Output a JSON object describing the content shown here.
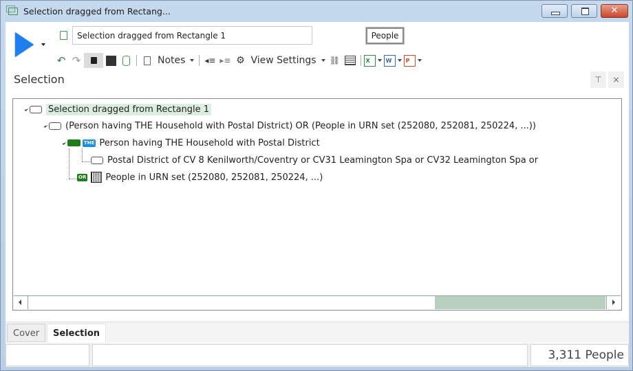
{
  "window": {
    "title": "Selection dragged from Rectang...",
    "controls": {
      "minimize": "minimize",
      "maximize": "maximize",
      "close": "✕"
    }
  },
  "header": {
    "selection_name": "Selection dragged from Rectangle 1",
    "resolve_table": "People"
  },
  "toolbar": {
    "notes_label": "Notes",
    "view_settings_label": "View Settings",
    "icons": [
      "undo-icon",
      "redo-icon",
      "lock-icon",
      "save-icon",
      "database-icon",
      "clipboard-icon",
      "outdent-icon",
      "indent-icon",
      "settings-doc-icon",
      "tree-icon",
      "grid-icon",
      "excel-icon",
      "word-icon",
      "powerpoint-icon"
    ],
    "excel_glyph": "X",
    "word_glyph": "W",
    "powerpoint_glyph": "P"
  },
  "pane": {
    "title": "Selection",
    "pin_glyph": "⊤",
    "close_glyph": "×"
  },
  "tree": {
    "nodes": [
      {
        "label": "Selection dragged from Rectangle 1",
        "level": 0,
        "selected": true
      },
      {
        "label": "(Person having THE Household with Postal District) OR (People in URN set (252080, 252081, 250224, ...))",
        "level": 1
      },
      {
        "label": "Person having THE Household with Postal District",
        "level": 2,
        "badge": "THE"
      },
      {
        "label": "Postal District of CV 8 Kenilworth/Coventry or CV31 Leamington Spa or CV32 Leamington Spa or",
        "level": 3
      },
      {
        "label": "People in URN set (252080, 252081, 250224, ...)",
        "level": 2,
        "badge": "OR"
      }
    ]
  },
  "scrollbar": {
    "horizontal_position_fraction": 0.7
  },
  "tabs": [
    {
      "label": "Cover",
      "active": false
    },
    {
      "label": "Selection",
      "active": true
    }
  ],
  "status": {
    "cell1": "",
    "cell2": "",
    "count": "3,311 People"
  }
}
